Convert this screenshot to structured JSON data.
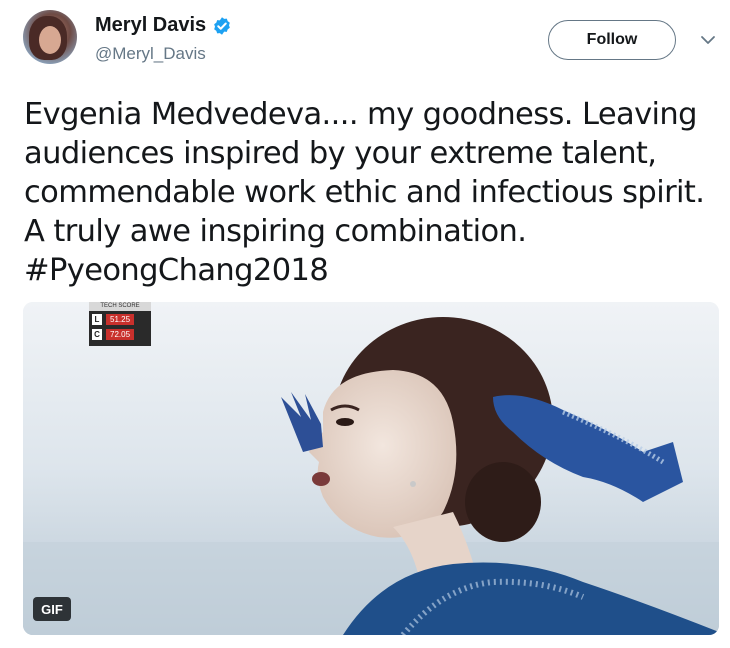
{
  "author": {
    "display_name": "Meryl Davis",
    "handle": "@Meryl_Davis",
    "verified": true
  },
  "actions": {
    "follow_label": "Follow"
  },
  "tweet": {
    "lines": [
      "Evgenia Medvedeva.... my goodness. Leaving",
      "audiences inspired by your extreme talent,",
      "commendable work ethic and infectious spirit.",
      "A truly awe inspiring combination.",
      "#PyeongChang2018"
    ]
  },
  "media": {
    "badge": "GIF",
    "score_overlay": {
      "title": "TECH SCORE",
      "rows": [
        {
          "key": "L",
          "value": "51.25"
        },
        {
          "key": "C",
          "value": "72.05"
        }
      ]
    }
  },
  "colors": {
    "verified_blue": "#1da1f2",
    "text_primary": "#14171a",
    "text_secondary": "#657786",
    "score_red": "#c9302c"
  }
}
